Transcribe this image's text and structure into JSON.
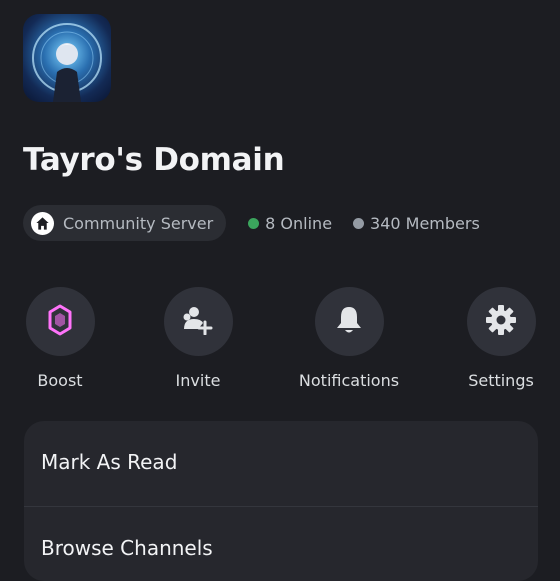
{
  "server": {
    "name": "Tayro's Domain",
    "community_label": "Community Server",
    "online_text": "8 Online",
    "members_text": "340 Members"
  },
  "colors": {
    "online": "#3ba55d",
    "members": "#949ba4",
    "boost": "#ff73fa"
  },
  "actions": [
    {
      "label": "Boost",
      "icon": "boost-gem-icon"
    },
    {
      "label": "Invite",
      "icon": "add-user-icon"
    },
    {
      "label": "Notifications",
      "icon": "bell-icon"
    },
    {
      "label": "Settings",
      "icon": "gear-icon"
    }
  ],
  "menu": {
    "items": [
      {
        "label": "Mark As Read"
      },
      {
        "label": "Browse Channels"
      }
    ]
  }
}
